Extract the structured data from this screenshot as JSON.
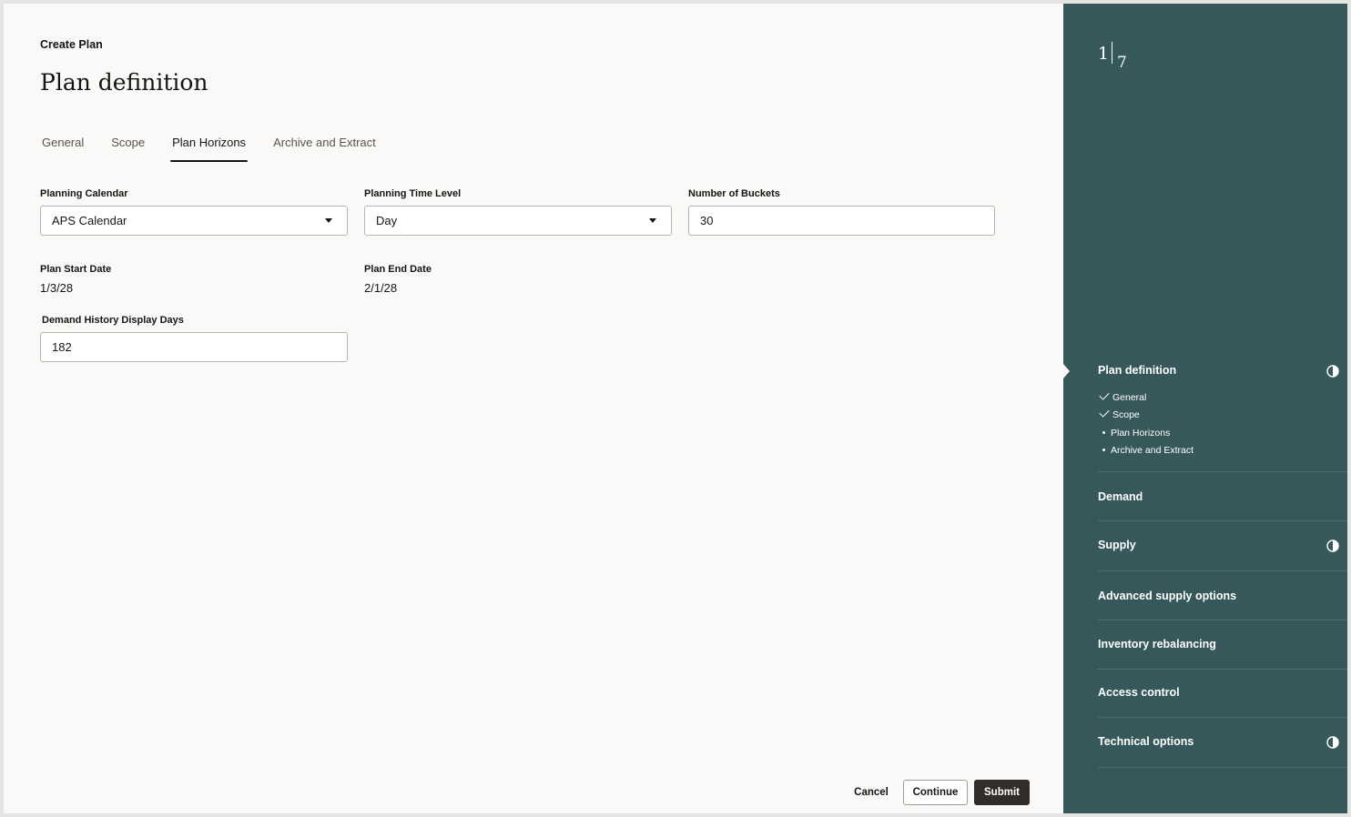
{
  "header": {
    "eyebrow": "Create Plan",
    "title": "Plan definition"
  },
  "tabs": [
    {
      "label": "General",
      "active": false
    },
    {
      "label": "Scope",
      "active": false
    },
    {
      "label": "Plan Horizons",
      "active": true
    },
    {
      "label": "Archive and Extract",
      "active": false
    }
  ],
  "form": {
    "planning_calendar": {
      "label": "Planning Calendar",
      "value": "APS Calendar"
    },
    "planning_time_level": {
      "label": "Planning Time Level",
      "value": "Day"
    },
    "number_of_buckets": {
      "label": "Number of Buckets",
      "value": "30"
    },
    "plan_start_date": {
      "label": "Plan Start Date",
      "value": "1/3/28"
    },
    "plan_end_date": {
      "label": "Plan End Date",
      "value": "2/1/28"
    },
    "demand_history_display_days": {
      "label": "Demand History Display Days",
      "value": "182"
    }
  },
  "footer": {
    "cancel_label": "Cancel",
    "continue_label": "Continue",
    "submit_label": "Submit"
  },
  "progress": {
    "current": "1",
    "total": "7",
    "sections": [
      {
        "label": "Plan definition",
        "status": "in-progress",
        "current": true,
        "items": [
          {
            "label": "General",
            "status": "complete"
          },
          {
            "label": "Scope",
            "status": "complete"
          },
          {
            "label": "Plan Horizons",
            "status": "pending"
          },
          {
            "label": "Archive and Extract",
            "status": "pending"
          }
        ]
      },
      {
        "label": "Demand",
        "status": "none"
      },
      {
        "label": "Supply",
        "status": "in-progress"
      },
      {
        "label": "Advanced supply options",
        "status": "none"
      },
      {
        "label": "Inventory rebalancing",
        "status": "none"
      },
      {
        "label": "Access control",
        "status": "none"
      },
      {
        "label": "Technical options",
        "status": "in-progress"
      }
    ]
  },
  "colors": {
    "panel_bg": "#36585a",
    "page_bg": "#faf9f7",
    "primary_button": "#312d2a"
  }
}
